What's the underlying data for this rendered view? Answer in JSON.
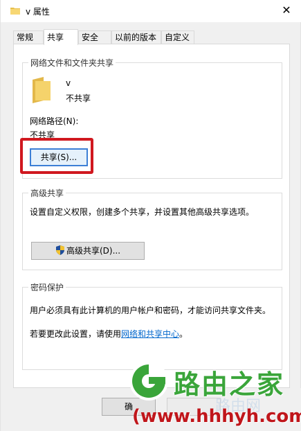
{
  "window": {
    "title": "v 属性",
    "close_glyph": "✕"
  },
  "tabs": [
    {
      "label": "常规"
    },
    {
      "label": "共享"
    },
    {
      "label": "安全"
    },
    {
      "label": "以前的版本"
    },
    {
      "label": "自定义"
    }
  ],
  "active_tab": "共享",
  "network_sharing": {
    "group_title": "网络文件和文件夹共享",
    "folder_name": "v",
    "folder_status": "不共享",
    "path_label": "网络路径(N):",
    "path_value": "不共享",
    "share_button": "共享(S)..."
  },
  "advanced_sharing": {
    "group_title": "高级共享",
    "description": "设置自定义权限，创建多个共享，并设置其他高级共享选项。",
    "button": "高级共享(D)..."
  },
  "password_protection": {
    "group_title": "密码保护",
    "description": "用户必须具有此计算机的用户帐户和密码，才能访问共享文件夹。",
    "change_prefix": "若要更改此设置，请使用",
    "change_link": "网络和共享中心",
    "change_suffix": "。"
  },
  "footer": {
    "ok_button_partial": "确"
  },
  "watermark": {
    "brand": "路由之家",
    "url": "(www.hhhyh.com)",
    "faint_text": "路由网"
  },
  "colors": {
    "highlight_border": "#d0181f",
    "brand_green": "#3aa53a",
    "url_red": "#c0161b",
    "link_blue": "#0066cc",
    "folder_yellow": "#f5d36b"
  },
  "icons": {
    "title": "folder-icon",
    "folder": "folder-icon",
    "shield": "uac-shield-icon",
    "close": "close-icon",
    "logo": "router-home-logo-icon"
  }
}
